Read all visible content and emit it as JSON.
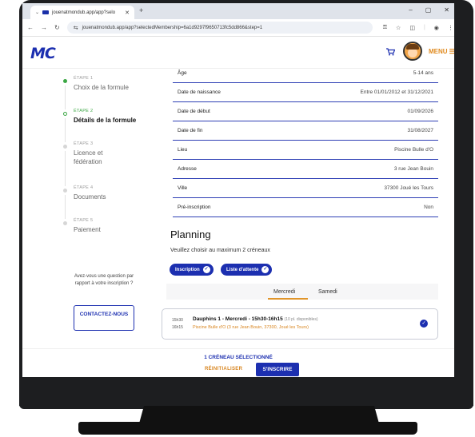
{
  "browser": {
    "tab_title": "jouenatmondub.app/app?selo",
    "url": "jouenatmondub.app/app?selectedMembership=6a1d9297f9650713fc5dd866&step=1"
  },
  "header": {
    "logo": "MC",
    "menu_label": "MENU"
  },
  "steps": [
    {
      "label": "ÉTAPE 1",
      "name": "Choix de la formule",
      "state": "done"
    },
    {
      "label": "ÉTAPE 2",
      "name": "Détails de la formule",
      "state": "current"
    },
    {
      "label": "ÉTAPE 3",
      "name": "Licence et fédération",
      "state": "todo"
    },
    {
      "label": "ÉTAPE 4",
      "name": "Documents",
      "state": "todo"
    },
    {
      "label": "ÉTAPE 5",
      "name": "Paiement",
      "state": "todo"
    }
  ],
  "help": {
    "text": "Avez-vous une question par rapport à votre inscription ?",
    "contact_label": "CONTACTEZ-NOUS"
  },
  "details": [
    {
      "label": "Âge",
      "value": "5-14 ans"
    },
    {
      "label": "Date de naissance",
      "value": "Entre 01/01/2012 et 31/12/2021"
    },
    {
      "label": "Date de début",
      "value": "01/09/2026"
    },
    {
      "label": "Date de fin",
      "value": "31/08/2027"
    },
    {
      "label": "Lieu",
      "value": "Piscine Bulle d'O"
    },
    {
      "label": "Adresse",
      "value": "3 rue Jean Bouin"
    },
    {
      "label": "Ville",
      "value": "37300 Joué les Tours"
    },
    {
      "label": "Pré-inscription",
      "value": "Non"
    }
  ],
  "planning": {
    "title": "Planning",
    "subtitle": "Veuillez choisir au maximum 2 créneaux",
    "filters": [
      "Inscription",
      "Liste d'attente"
    ],
    "days": [
      "Mercredi",
      "Samedi"
    ],
    "active_day": "Mercredi",
    "slot": {
      "start": "15h30",
      "end": "16h15",
      "title": "Dauphins 1 - Mercredi - 15h30-16h15",
      "availability": "(10 pl. disponibles)",
      "place": "Piscine Bulle d'O (3 rue Jean Bouin, 37300, Joué les Tours)"
    }
  },
  "footer": {
    "selected": "1 CRÉNEAU SÉLECTIONNÉ",
    "reset_label": "RÉINITIALISER",
    "signup_label": "S'INSCRIRE"
  },
  "colors": {
    "brand_blue": "#1c2fb0",
    "accent_orange": "#e08a1e",
    "step_green": "#3ba744"
  }
}
